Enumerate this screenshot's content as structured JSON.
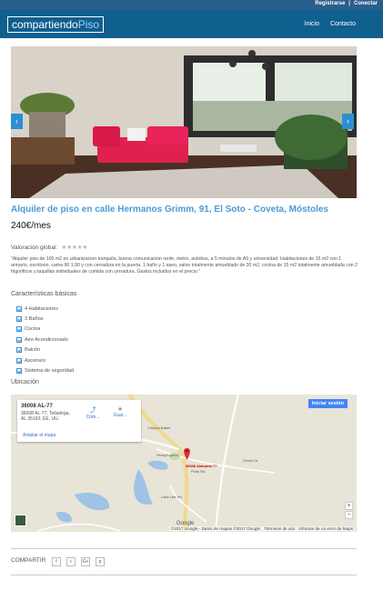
{
  "topbar": {
    "register": "Registrarse",
    "separator": "|",
    "login": "Conectar"
  },
  "header": {
    "logo_main": "compartiendo",
    "logo_accent": "Piso",
    "nav": [
      "Inicio",
      "Contacto"
    ]
  },
  "carousel": {
    "prev_icon": "chevron-left-icon",
    "next_icon": "chevron-right-icon",
    "prev": "‹",
    "next": "›"
  },
  "listing": {
    "title": "Alquiler de piso en calle Hermanos Grimm, 91, El Soto - Coveta, Móstoles",
    "price": "240€/mes",
    "rating_label": "Valoración global:",
    "rating_stars": "★★★★★",
    "description": "\"Alquiler piso de 100 m2 en urbanizacion tranquila, buena comunicacion renfe, metro, autobus, a 5 minutos de A5 y universidad. Habitaciones de 15 m2 con 1 armario, escritorio, cama 90 1,90 y con cerradura en la puerta. 1 baño y 1 aseo, salon totalmente amueblado de 30 m2, cocina de 15 m2 totalmente amueblada con 2 frigorificos y taquillas individuales de comida con cerradura. Gastos incluidos en el precio.\""
  },
  "features": {
    "title": "Características básicas",
    "items": [
      "4 Habitaciones",
      "3 Baños",
      "Cocina",
      "Aire Acondicionado",
      "Balcón",
      "Ascensor",
      "Sistema de seguridad"
    ]
  },
  "location": {
    "title": "Ubicación",
    "card_title": "36008 AL-77",
    "card_address": "36008 AL-77, Telladega, AL 35160, EE. UU.",
    "card_link": "Ampliar el mapa",
    "action1": "Cóm...",
    "action2": "Guar...",
    "signin": "Iniciar sesión",
    "pin_label": "36008 Alabama 77",
    "zoom_in": "+",
    "zoom_out": "−",
    "google": "Google",
    "footer": [
      "©2017 Google - Datos de mapas ©2017 Google",
      "Términos de uso",
      "Informar de un error de Maps"
    ],
    "place_labels": [
      "Cheyon Baker",
      "Pecky's pond",
      "Pinto Rd",
      "Lake Lee Rd",
      "Green Dr"
    ]
  },
  "share": {
    "label": "COMPARTIR",
    "buttons": [
      "f",
      "t",
      "G+",
      "p"
    ]
  }
}
